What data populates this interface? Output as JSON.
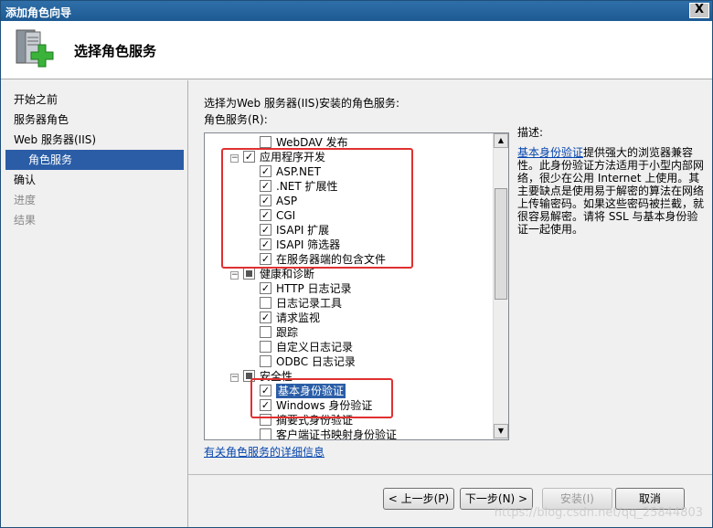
{
  "window": {
    "title": "添加角色向导",
    "close_label": "X"
  },
  "header": {
    "title": "选择角色服务"
  },
  "nav": [
    "开始之前",
    "服务器角色",
    "Web 服务器(IIS)",
    "角色服务",
    "确认",
    "进度",
    "结果"
  ],
  "main": {
    "instruction": "选择为Web 服务器(IIS)安装的角色服务:",
    "list_label": "角色服务(R):",
    "items": [
      "WebDAV 发布",
      "应用程序开发",
      "ASP.NET",
      ".NET 扩展性",
      "ASP",
      "CGI",
      "ISAPI 扩展",
      "ISAPI 筛选器",
      "在服务器端的包含文件",
      "健康和诊断",
      "HTTP 日志记录",
      "日志记录工具",
      "请求监视",
      "跟踪",
      "自定义日志记录",
      "ODBC 日志记录",
      "安全性",
      "基本身份验证",
      "Windows 身份验证",
      "摘要式身份验证",
      "客户端证书映射身份验证"
    ],
    "desc_label": "描述:",
    "desc_link": "基本身份验证",
    "desc_text": "提供强大的浏览器兼容性。此身份验证方法适用于小型内部网络，很少在公用 Internet 上使用。其主要缺点是使用易于解密的算法在网络上传输密码。如果这些密码被拦截，就很容易解密。请将 SSL 与基本身份验证一起使用。",
    "more_link": "有关角色服务的详细信息"
  },
  "buttons": {
    "prev": "< 上一步(P)",
    "next": "下一步(N) >",
    "install": "安装(I)",
    "cancel": "取消"
  },
  "watermark": "https://blog.csdn.net/qq_25844803",
  "colors": {
    "selection": "#2a5da6",
    "highlight_box": "#e03030",
    "link": "#0645ad"
  }
}
